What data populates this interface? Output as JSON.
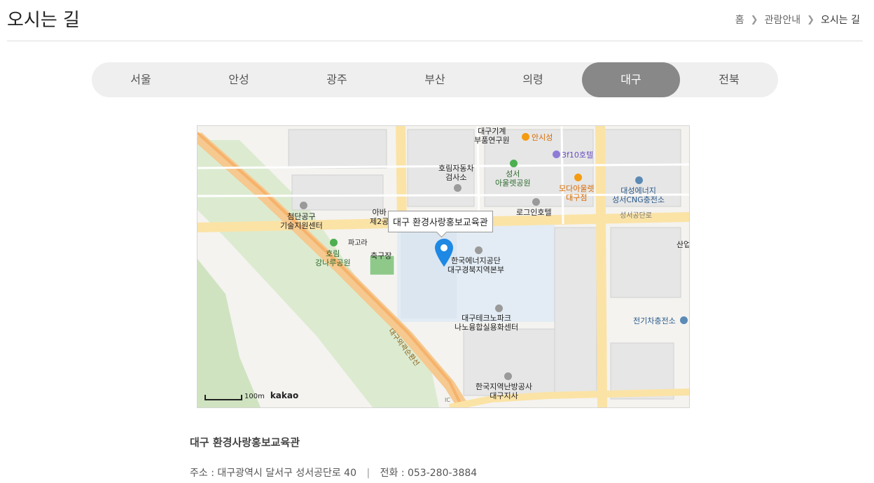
{
  "header": {
    "title": "오시는 길",
    "breadcrumb": [
      "홈",
      "관람안내",
      "오시는 길"
    ]
  },
  "tabs": [
    {
      "label": "서울",
      "active": false
    },
    {
      "label": "안성",
      "active": false
    },
    {
      "label": "광주",
      "active": false
    },
    {
      "label": "부산",
      "active": false
    },
    {
      "label": "의령",
      "active": false
    },
    {
      "label": "대구",
      "active": true
    },
    {
      "label": "전북",
      "active": false
    }
  ],
  "map": {
    "infobox": "대구 환경사랑홍보교육관",
    "scale": "100m",
    "brand": "kakao",
    "labels": {
      "l1": "대구기계\n부품연구원",
      "l2": "안시성",
      "l3": "3f10호텔",
      "l4": "호림자동차\n검사소",
      "l5": "성서\n아울렛공원",
      "l6": "모다아울렛\n대구점",
      "l7": "대성에너지\n성서CNG충전소",
      "l8": "첨단공구\n기술지원센터",
      "l9": "아바\n제2공",
      "l10": "로그인호텔",
      "l11": "성서공단로",
      "l12": "파고라",
      "l13": "호림\n강나루공원",
      "l14": "축구장",
      "l15": "한국에너지공단\n대구경북지역본부",
      "l16": "대구테크노파크\n나노융합실용화센터",
      "l17": "대구외곽순환선",
      "l18": "한국지역난방공사\n대구지사",
      "l19": "전기차충전소",
      "l20": "산업",
      "l21": "IC"
    }
  },
  "info": {
    "title": "대구 환경사랑홍보교육관",
    "address": "주소 : 대구광역시 달서구 성서공단로 40",
    "separator": "|",
    "phone": "전화 : 053-280-3884"
  }
}
